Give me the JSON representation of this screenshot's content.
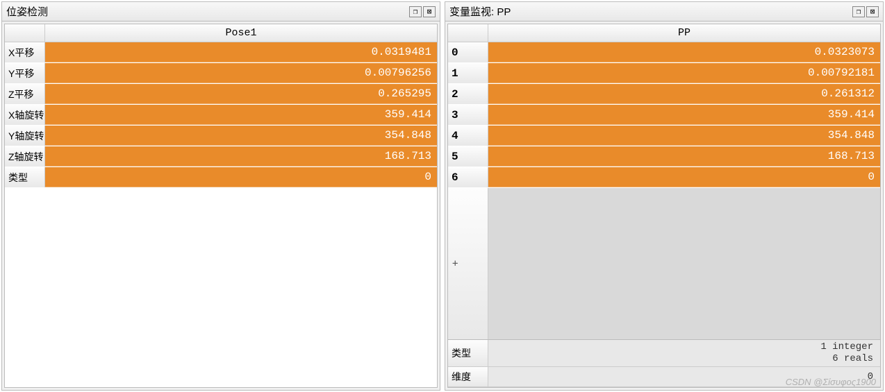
{
  "left_panel": {
    "title": "位姿检测",
    "header": "Pose1",
    "rows": [
      {
        "label": "X平移",
        "value": "0.0319481"
      },
      {
        "label": "Y平移",
        "value": "0.00796256"
      },
      {
        "label": "Z平移",
        "value": "0.265295"
      },
      {
        "label": "X轴旋转",
        "value": "359.414"
      },
      {
        "label": "Y轴旋转",
        "value": "354.848"
      },
      {
        "label": "Z轴旋转",
        "value": "168.713"
      },
      {
        "label": "类型",
        "value": "0"
      }
    ]
  },
  "right_panel": {
    "title": "变量监视: PP",
    "header": "PP",
    "rows": [
      {
        "label": "0",
        "value": "0.0323073"
      },
      {
        "label": "1",
        "value": "0.00792181"
      },
      {
        "label": "2",
        "value": "0.261312"
      },
      {
        "label": "3",
        "value": "359.414"
      },
      {
        "label": "4",
        "value": "354.848"
      },
      {
        "label": "5",
        "value": "168.713"
      },
      {
        "label": "6",
        "value": "0"
      }
    ],
    "plus": "+",
    "summary": {
      "type_label": "类型",
      "type_value_line1": "1 integer",
      "type_value_line2": "6 reals",
      "dim_label": "维度",
      "dim_value": "0"
    }
  },
  "window_buttons": {
    "maximize": "❐",
    "close": "⊠"
  },
  "watermark": "CSDN @Σίσυφος1900"
}
